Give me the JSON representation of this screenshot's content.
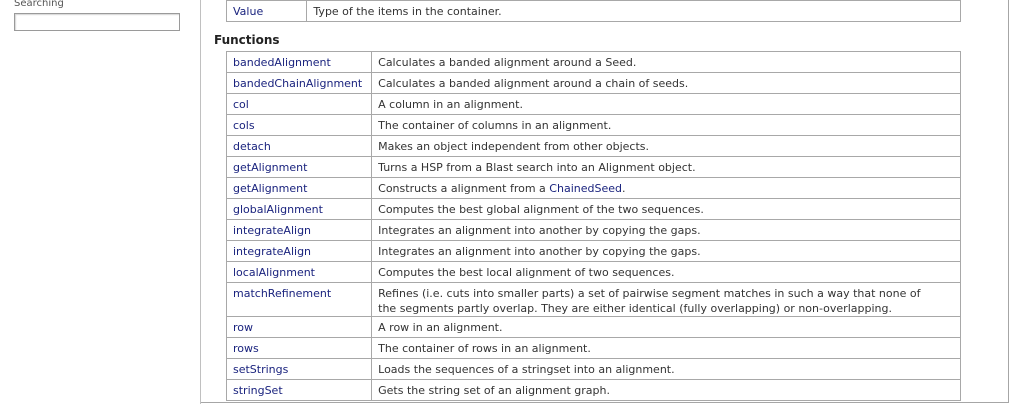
{
  "sidebar": {
    "label": "Searching",
    "search_value": ""
  },
  "types_row": {
    "name": "Value",
    "description": "Type of the items in the container."
  },
  "functions": {
    "heading": "Functions",
    "rows": [
      {
        "name": "bandedAlignment",
        "description": "Calculates a banded alignment around a Seed."
      },
      {
        "name": "bandedChainAlignment",
        "description": "Calculates a banded alignment around a chain of seeds."
      },
      {
        "name": "col",
        "description": "A column in an alignment."
      },
      {
        "name": "cols",
        "description": "The container of columns in an alignment."
      },
      {
        "name": "detach",
        "description": "Makes an object independent from other objects."
      },
      {
        "name": "getAlignment",
        "description": "Turns a HSP from a Blast search into an Alignment object."
      },
      {
        "name": "getAlignment",
        "description_prefix": "Constructs a alignment from a ",
        "description_link": "ChainedSeed",
        "description_suffix": "."
      },
      {
        "name": "globalAlignment",
        "description": "Computes the best global alignment of the two sequences."
      },
      {
        "name": "integrateAlign",
        "description": "Integrates an alignment into another by copying the gaps."
      },
      {
        "name": "integrateAlign",
        "description": "Integrates an alignment into another by copying the gaps."
      },
      {
        "name": "localAlignment",
        "description": "Computes the best local alignment of two sequences."
      },
      {
        "name": "matchRefinement",
        "description_line1": "Refines (i.e. cuts into smaller parts) a set of pairwise segment matches in such a way that none of",
        "description_line2": "the segments partly overlap. They are either identical (fully overlapping) or non-overlapping."
      },
      {
        "name": "row",
        "description": "A row in an alignment."
      },
      {
        "name": "rows",
        "description": "The container of rows in an alignment."
      },
      {
        "name": "setStrings",
        "description": "Loads the sequences of a stringset into an alignment."
      },
      {
        "name": "stringSet",
        "description": "Gets the string set of an alignment graph."
      }
    ]
  }
}
